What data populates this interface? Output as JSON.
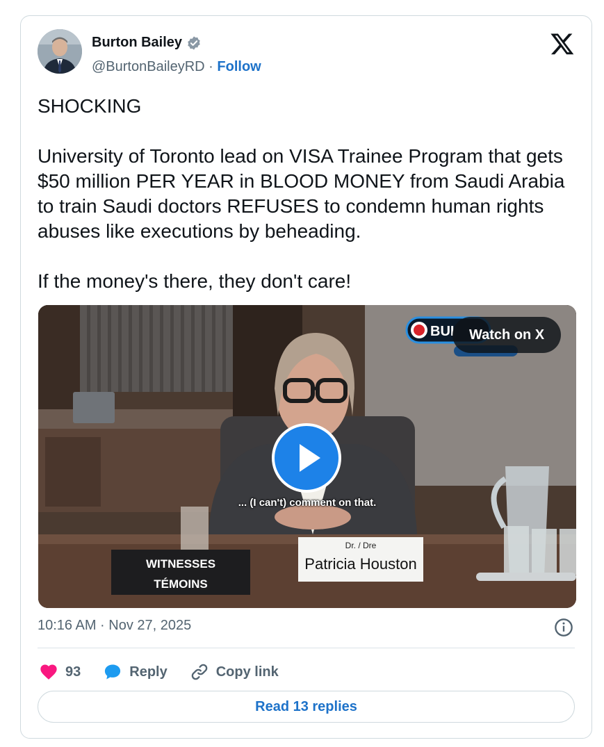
{
  "author": {
    "name": "Burton Bailey",
    "handle": "@BurtonBaileyRD",
    "separator": "·",
    "follow_label": "Follow"
  },
  "tweet": {
    "text": "SHOCKING\n\nUniversity of Toronto lead on VISA Trainee Program that gets $50 million PER YEAR in BLOOD MONEY from Saudi Arabia to train Saudi doctors REFUSES to condemn human rights abuses like executions by beheading.\n\nIf the money's there, they don't care!"
  },
  "video": {
    "watch_label": "Watch on X",
    "caption": "... (I can't) comment on that.",
    "channel_logo_text": "BUI",
    "witness_sign_line1": "WITNESSES",
    "witness_sign_line2": "TÉMOINS",
    "nameplate_title": "Dr. / Dre",
    "nameplate_name": "Patricia Houston"
  },
  "meta": {
    "timestamp": "10:16 AM · Nov 27, 2025"
  },
  "actions": {
    "like_count": "93",
    "reply_label": "Reply",
    "copy_link_label": "Copy link"
  },
  "read_replies_label": "Read 13 replies",
  "colors": {
    "link_blue": "#1d72c9",
    "verified_blue": "#8a98a5",
    "like_pink": "#f91880",
    "reply_blue": "#1d9bf0"
  }
}
